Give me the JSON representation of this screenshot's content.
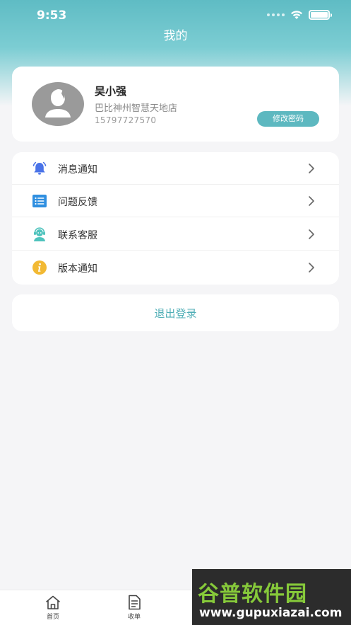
{
  "status_bar": {
    "time": "9:53"
  },
  "header": {
    "title": "我的"
  },
  "profile": {
    "name": "吴小强",
    "store": "巴比神州智慧天地店",
    "phone": "15797727570",
    "change_password_label": "修改密码"
  },
  "menu": {
    "items": [
      {
        "label": "消息通知",
        "icon": "bell-icon",
        "color": "#4a73e8"
      },
      {
        "label": "问题反馈",
        "icon": "list-icon",
        "color": "#2f8fe0"
      },
      {
        "label": "联系客服",
        "icon": "support-agent-icon",
        "color": "#4fc3bd"
      },
      {
        "label": "版本通知",
        "icon": "info-icon",
        "color": "#f2b933"
      }
    ]
  },
  "logout": {
    "label": "退出登录"
  },
  "tabbar": {
    "tabs": [
      {
        "label": "首页",
        "icon": "home-icon"
      },
      {
        "label": "收单",
        "icon": "document-icon"
      }
    ]
  },
  "watermark": {
    "title": "谷普软件园",
    "url": "www.gupuxiazai.com"
  },
  "colors": {
    "accent": "#5db8c0",
    "logout_text": "#4faeb6"
  }
}
